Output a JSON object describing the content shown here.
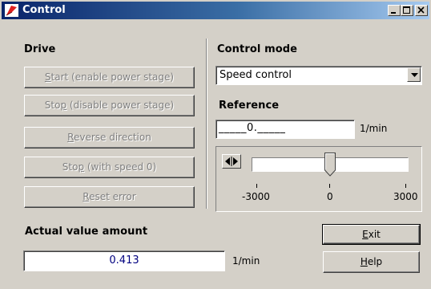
{
  "window": {
    "title": "Control"
  },
  "drive": {
    "heading": "Drive",
    "buttons": [
      {
        "accel": "S",
        "rest": "tart (enable power stage)"
      },
      {
        "pre": "Sto",
        "accel": "p",
        "rest": " (disable power stage)"
      },
      {
        "accel": "R",
        "rest": "everse direction"
      },
      {
        "pre": "Sto",
        "accel": "p",
        "rest": " (with speed 0)"
      },
      {
        "accel": "R",
        "rest": "eset error"
      }
    ]
  },
  "control_mode": {
    "heading": "Control mode",
    "selected": "Speed control"
  },
  "reference": {
    "heading": "Reference",
    "value": "_____0._____",
    "unit": "1/min",
    "slider": {
      "min_label": "-3000",
      "mid_label": "0",
      "max_label": "3000",
      "level": 0.5
    }
  },
  "actual": {
    "heading": "Actual value amount",
    "value": "0.413",
    "unit": "1/min"
  },
  "buttons": {
    "exit": {
      "accel": "E",
      "rest": "xit"
    },
    "help": {
      "accel": "H",
      "rest": "elp"
    }
  }
}
